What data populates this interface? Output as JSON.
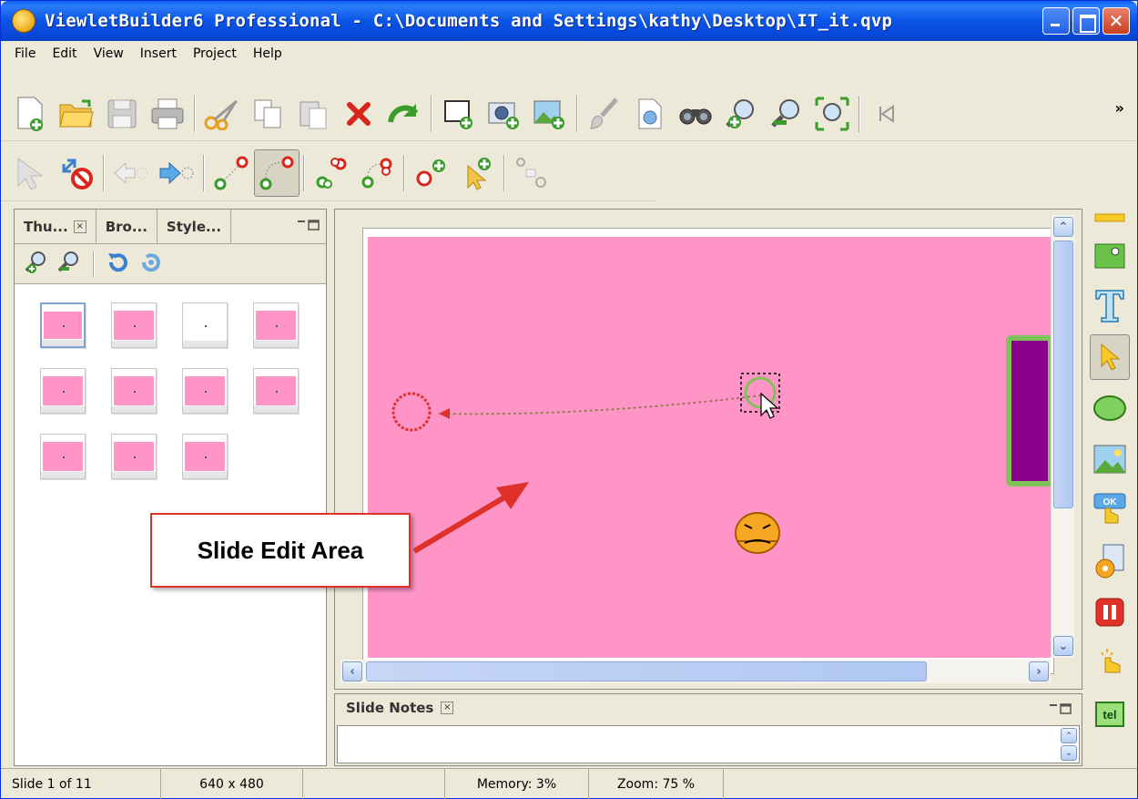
{
  "window": {
    "title": "ViewletBuilder6 Professional - C:\\Documents and Settings\\kathy\\Desktop\\IT_it.qvp"
  },
  "menu": [
    "File",
    "Edit",
    "View",
    "Insert",
    "Project",
    "Help"
  ],
  "toolbar_overflow": "»",
  "left_panel": {
    "tabs": [
      "Thu...",
      "Bro...",
      "Style..."
    ],
    "tab_close": "×",
    "thumbnails": [
      {
        "body": "pink",
        "selected": true
      },
      {
        "body": "pink"
      },
      {
        "body": "white"
      },
      {
        "body": "pink"
      },
      {
        "body": "pink"
      },
      {
        "body": "pink"
      },
      {
        "body": "pink"
      },
      {
        "body": "pink"
      },
      {
        "body": "pink"
      },
      {
        "body": "pink"
      },
      {
        "body": "pink"
      }
    ]
  },
  "annotation": {
    "label": "Slide Edit Area"
  },
  "notes": {
    "tab_label": "Slide Notes",
    "tab_close": "×"
  },
  "status": {
    "slide": "Slide 1 of 11",
    "size": "640 x 480",
    "memory": "Memory: 3%",
    "zoom": "Zoom: 75 %"
  },
  "colors": {
    "slide_bg": "#fe95c6",
    "accent_red": "#e0302a",
    "purple_box": "#8b008b",
    "green_border": "#7fc25a"
  }
}
